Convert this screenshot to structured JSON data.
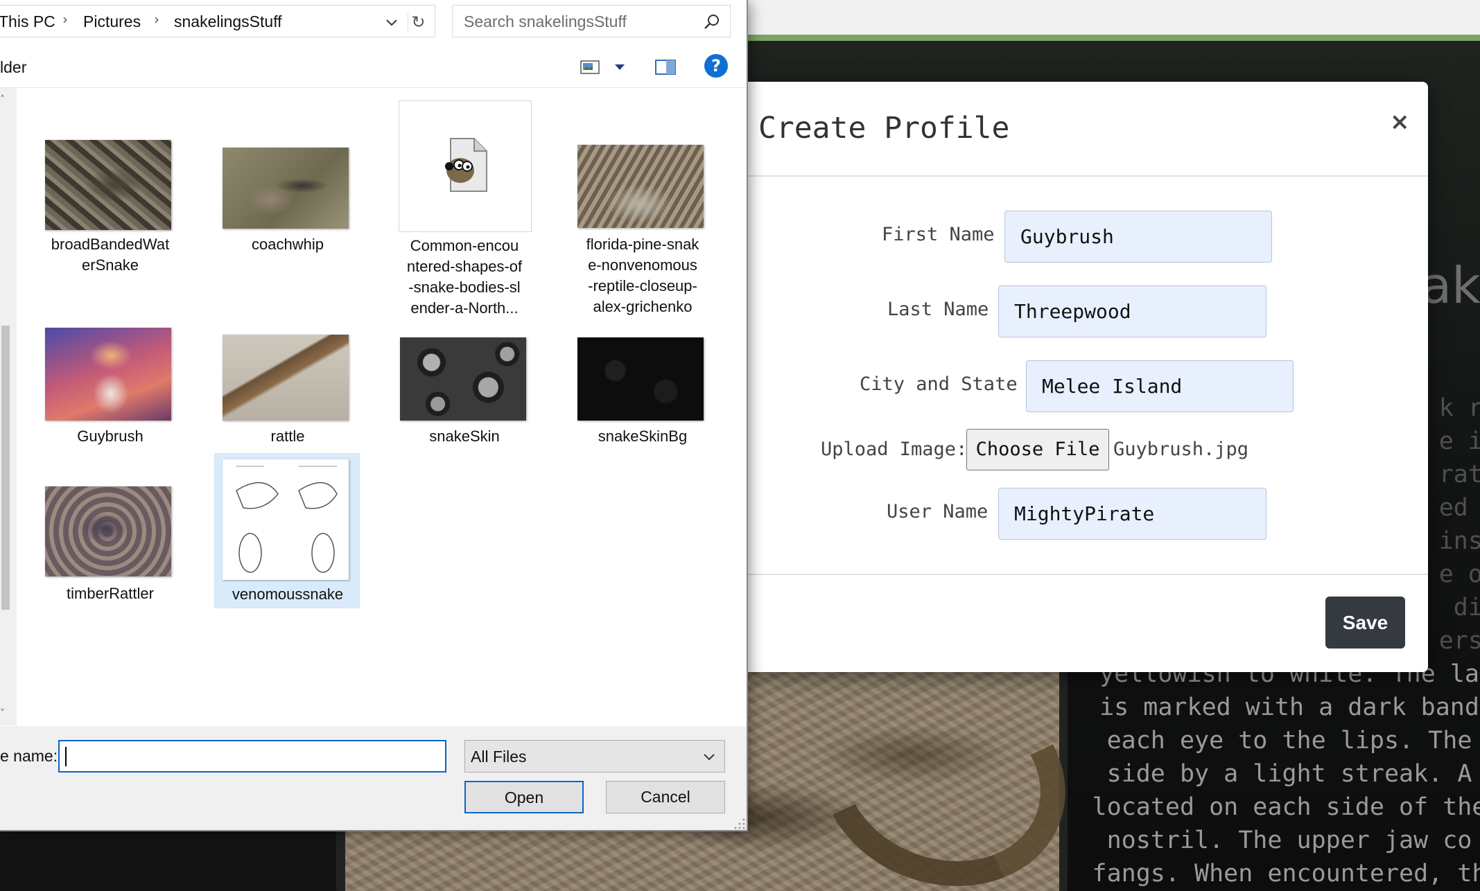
{
  "dialog": {
    "breadcrumbs": [
      "This PC",
      "Pictures",
      "snakelingsStuff"
    ],
    "search_placeholder": "Search snakelingsStuff",
    "toolbar_text": "lder",
    "help_glyph": "?",
    "files": [
      {
        "label": "broadBandedWat\nerSnake"
      },
      {
        "label": "coachwhip"
      },
      {
        "label": "Common-encou\nntered-shapes-of\n-snake-bodies-sl\nender-a-North..."
      },
      {
        "label": "florida-pine-snak\ne-nonvenomous\n-reptile-closeup-\nalex-grichenko"
      },
      {
        "label": "Guybrush"
      },
      {
        "label": "rattle"
      },
      {
        "label": "snakeSkin"
      },
      {
        "label": "snakeSkinBg"
      },
      {
        "label": "timberRattler"
      },
      {
        "label": "venomoussnake"
      }
    ],
    "file_name_label": "e name:",
    "file_name_value": "",
    "filter_value": "All Files",
    "open_label": "Open",
    "cancel_label": "Cancel",
    "icons": [
      "chevron-down-icon",
      "refresh-icon",
      "search-icon",
      "view-icon",
      "preview-pane-icon",
      "help-icon",
      "gimp-file-icon"
    ],
    "colors": {
      "selection": "#d9ebfb",
      "focus": "#0a64c8",
      "help": "#0f6fd3"
    }
  },
  "modal": {
    "title": "Create Profile",
    "close_glyph": "×",
    "first_name_label": "First Name",
    "first_name_value": "Guybrush",
    "last_name_label": "Last Name",
    "last_name_value": "Threepwood",
    "city_label": "City and State",
    "city_value": "Melee Island",
    "upload_label": "Upload Image:",
    "choose_file_label": "Choose File",
    "chosen_file": "Guybrush.jpg",
    "username_label": "User Name",
    "username_value": "MightyPirate",
    "save_label": "Save",
    "colors": {
      "input_bg": "#e8f0fe",
      "save_bg": "#343a40"
    }
  },
  "background": {
    "heading_fragment": "ak",
    "text_lines": [
      "k ra",
      "e in",
      "ratt",
      "ed o",
      "inst",
      "e of",
      "dia",
      "ers.",
      "yellowish to white. The la",
      "is marked with a dark band",
      "each eye to the lips. The",
      "side by a light streak. A",
      "located on each side of the",
      "nostril. The upper jaw co",
      "fangs. When encountered, th"
    ],
    "accent_color": "#7ea467"
  }
}
